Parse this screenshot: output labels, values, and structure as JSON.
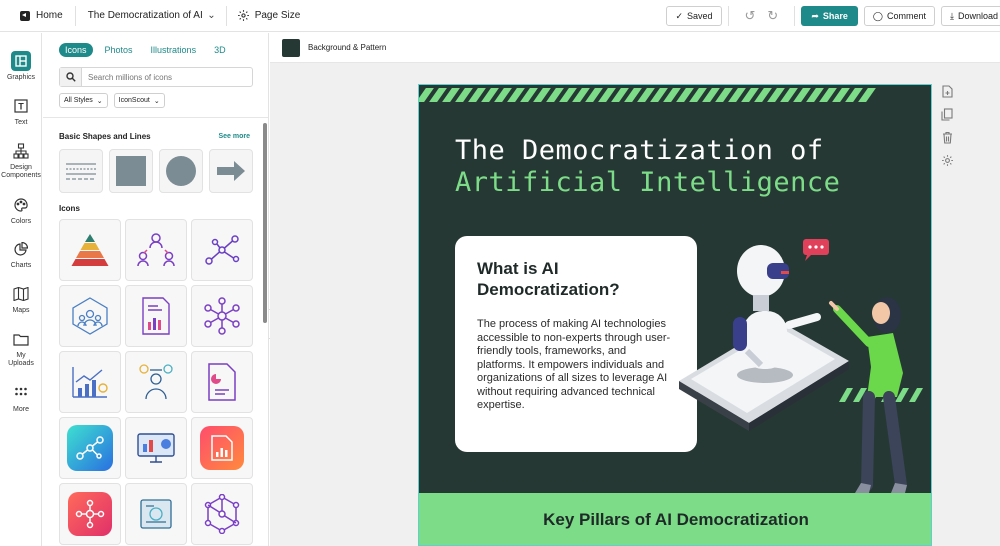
{
  "topbar": {
    "home_label": "Home",
    "doc_title": "The Democratization of AI",
    "page_size_label": "Page Size",
    "saved_label": "Saved",
    "share_label": "Share",
    "comment_label": "Comment",
    "download_label": "Download"
  },
  "rail": {
    "items": [
      {
        "label": "Graphics"
      },
      {
        "label": "Text"
      },
      {
        "label": "Design Components"
      },
      {
        "label": "Colors"
      },
      {
        "label": "Charts"
      },
      {
        "label": "Maps"
      },
      {
        "label": "My Uploads"
      },
      {
        "label": "More"
      }
    ]
  },
  "panel": {
    "tabs": [
      "Icons",
      "Photos",
      "Illustrations",
      "3D"
    ],
    "search_placeholder": "Search millions of icons",
    "filter_style": "All Styles",
    "filter_source": "IconScout",
    "basic_title": "Basic Shapes and Lines",
    "see_more": "See more",
    "icons_title": "Icons"
  },
  "canvas": {
    "bg_label": "Background & Pattern",
    "swatch_color": "#253834"
  },
  "poster": {
    "headline_line1": "The Democratization of",
    "headline_line2": "Artificial Intelligence",
    "card_title": "What is AI Democratization?",
    "card_body": "The process of making AI technologies accessible to non-experts through user-friendly tools, frameworks, and platforms. It empowers individuals and organizations of all sizes to leverage AI without requiring advanced technical expertise.",
    "pillars_title": "Key Pillars of AI Democratization"
  },
  "colors": {
    "accent": "#1f8a8a",
    "poster_bg": "#253834",
    "poster_green": "#7ddc88"
  }
}
